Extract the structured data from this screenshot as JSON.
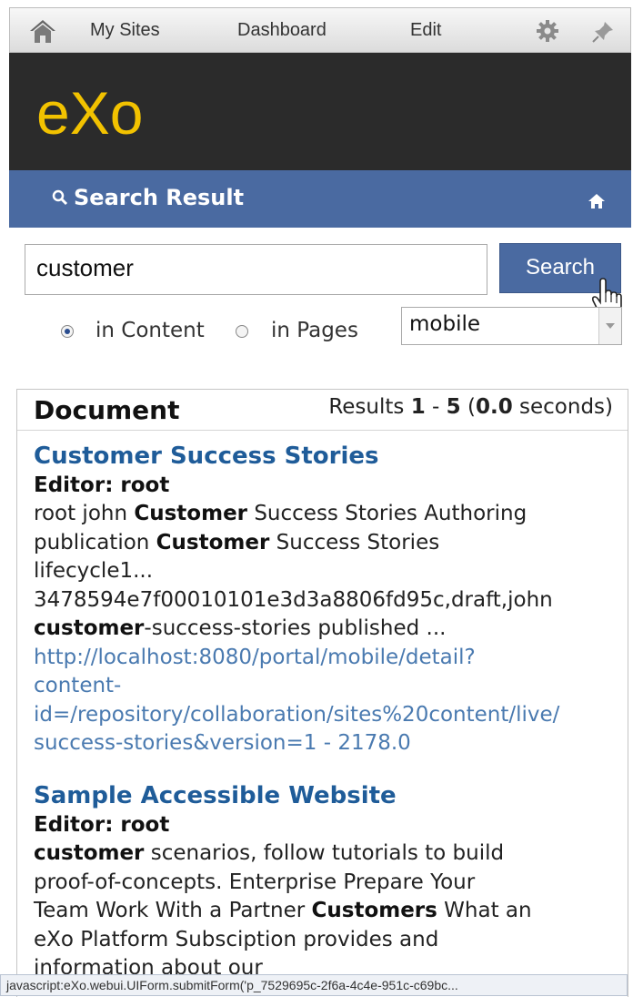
{
  "toolbar": {
    "my_sites": "My Sites",
    "dashboard": "Dashboard",
    "edit": "Edit"
  },
  "logo": {
    "text": "eXo",
    "color": "#f2c200"
  },
  "portlet": {
    "title": "Search Result"
  },
  "search": {
    "query": "customer",
    "button": "Search",
    "scope_content": "in Content",
    "scope_pages": "in Pages",
    "scope_selected": "content",
    "site_select": "mobile"
  },
  "results_header": {
    "title": "Document",
    "prefix": "Results ",
    "from": "1",
    "sep": " - ",
    "to": "5",
    "time_open": " (",
    "time": "0.0",
    "time_close": " seconds)"
  },
  "results": [
    {
      "title": "Customer Success Stories",
      "editor": "Editor: root",
      "l1a": "root john ",
      "l1b": "Customer",
      "l1c": " Success Stories Authoring",
      "l2a": "publication ",
      "l2b": "Customer",
      "l2c": " Success Stories",
      "l3": "lifecycle1...",
      "l4": "3478594e7f00010101e3d3a8806fd95c,draft,john",
      "l5a": "customer",
      "l5b": "-success-stories published ...",
      "u1": "http://localhost:8080/portal/mobile/detail?",
      "u2": "content-",
      "u3": "id=/repository/collaboration/sites%20content/live/",
      "u4": "success-stories&version=1 - 2178.0"
    },
    {
      "title": "Sample Accessible Website",
      "editor": "Editor: root",
      "l1a": "customer",
      "l1b": " scenarios, follow tutorials to build",
      "l2": "proof-of-concepts. Enterprise Prepare Your",
      "l3a": "Team Work With a Partner ",
      "l3b": "Customers",
      "l3c": " What an",
      "l4": "eXo Platform Subsciption provides and",
      "l5": "information about our"
    }
  ],
  "status_bar": "javascript:eXo.webui.UIForm.submitForm('p_7529695c-2f6a-4c4e-951c-c69bc...",
  "colors": {
    "accent": "#4a6aa1",
    "link": "#1f5c99",
    "banner": "#2b2b2b"
  }
}
